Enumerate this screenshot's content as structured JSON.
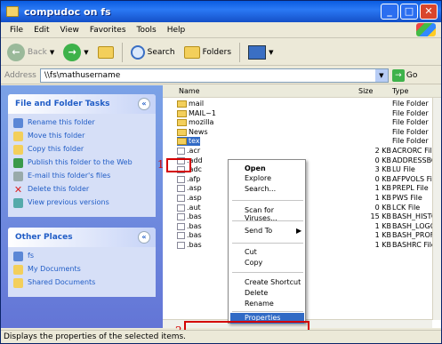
{
  "window": {
    "title": "compudoc on fs"
  },
  "menubar": [
    "File",
    "Edit",
    "View",
    "Favorites",
    "Tools",
    "Help"
  ],
  "toolbar": {
    "back": "Back",
    "search": "Search",
    "folders": "Folders"
  },
  "address": {
    "label": "Address",
    "value": "\\\\fs\\mathusername",
    "go": "Go"
  },
  "tasks": {
    "title": "File and Folder Tasks",
    "items": [
      "Rename this folder",
      "Move this folder",
      "Copy this folder",
      "Publish this folder to the Web",
      "E-mail this folder's files",
      "Delete this folder",
      "View previous versions"
    ]
  },
  "places": {
    "title": "Other Places",
    "items": [
      "fs",
      "My Documents",
      "Shared Documents"
    ]
  },
  "columns": {
    "name": "Name",
    "size": "Size",
    "type": "Type"
  },
  "files": [
    {
      "name": "mail",
      "size": "",
      "type": "File Folder"
    },
    {
      "name": "MAIL~1",
      "size": "",
      "type": "File Folder"
    },
    {
      "name": "mozilla",
      "size": "",
      "type": "File Folder"
    },
    {
      "name": "News",
      "size": "",
      "type": "File Folder"
    },
    {
      "name": "tex",
      "size": "",
      "type": "File Folder"
    },
    {
      "name": ".acr",
      "size": "2 KB",
      "type": "ACRORC File"
    },
    {
      "name": ".add",
      "size": "0 KB",
      "type": "ADDRESSBO"
    },
    {
      "name": ".adc",
      "size": "3 KB",
      "type": "LU File"
    },
    {
      "name": ".afp",
      "size": "0 KB",
      "type": "AFPVOLS File"
    },
    {
      "name": ".asp",
      "size": "1 KB",
      "type": "PREPL File"
    },
    {
      "name": ".asp",
      "size": "1 KB",
      "type": "PWS File"
    },
    {
      "name": ".aut",
      "size": "0 KB",
      "type": "LCK File"
    },
    {
      "name": ".bas",
      "size": "15 KB",
      "type": "BASH_HISTC"
    },
    {
      "name": ".bas",
      "size": "1 KB",
      "type": "BASH_LOGO"
    },
    {
      "name": ".bas",
      "size": "1 KB",
      "type": "BASH_PROF"
    },
    {
      "name": ".bas",
      "size": "1 KB",
      "type": "BASHRC File"
    }
  ],
  "context_menu": {
    "open": "Open",
    "explore": "Explore",
    "search": "Search...",
    "scan": "Scan for Viruses...",
    "send_to": "Send To",
    "cut": "Cut",
    "copy": "Copy",
    "create_shortcut": "Create Shortcut",
    "delete": "Delete",
    "rename": "Rename",
    "properties": "Properties"
  },
  "markers": {
    "one": "1",
    "two": "2"
  },
  "status": "Displays the properties of the selected items."
}
